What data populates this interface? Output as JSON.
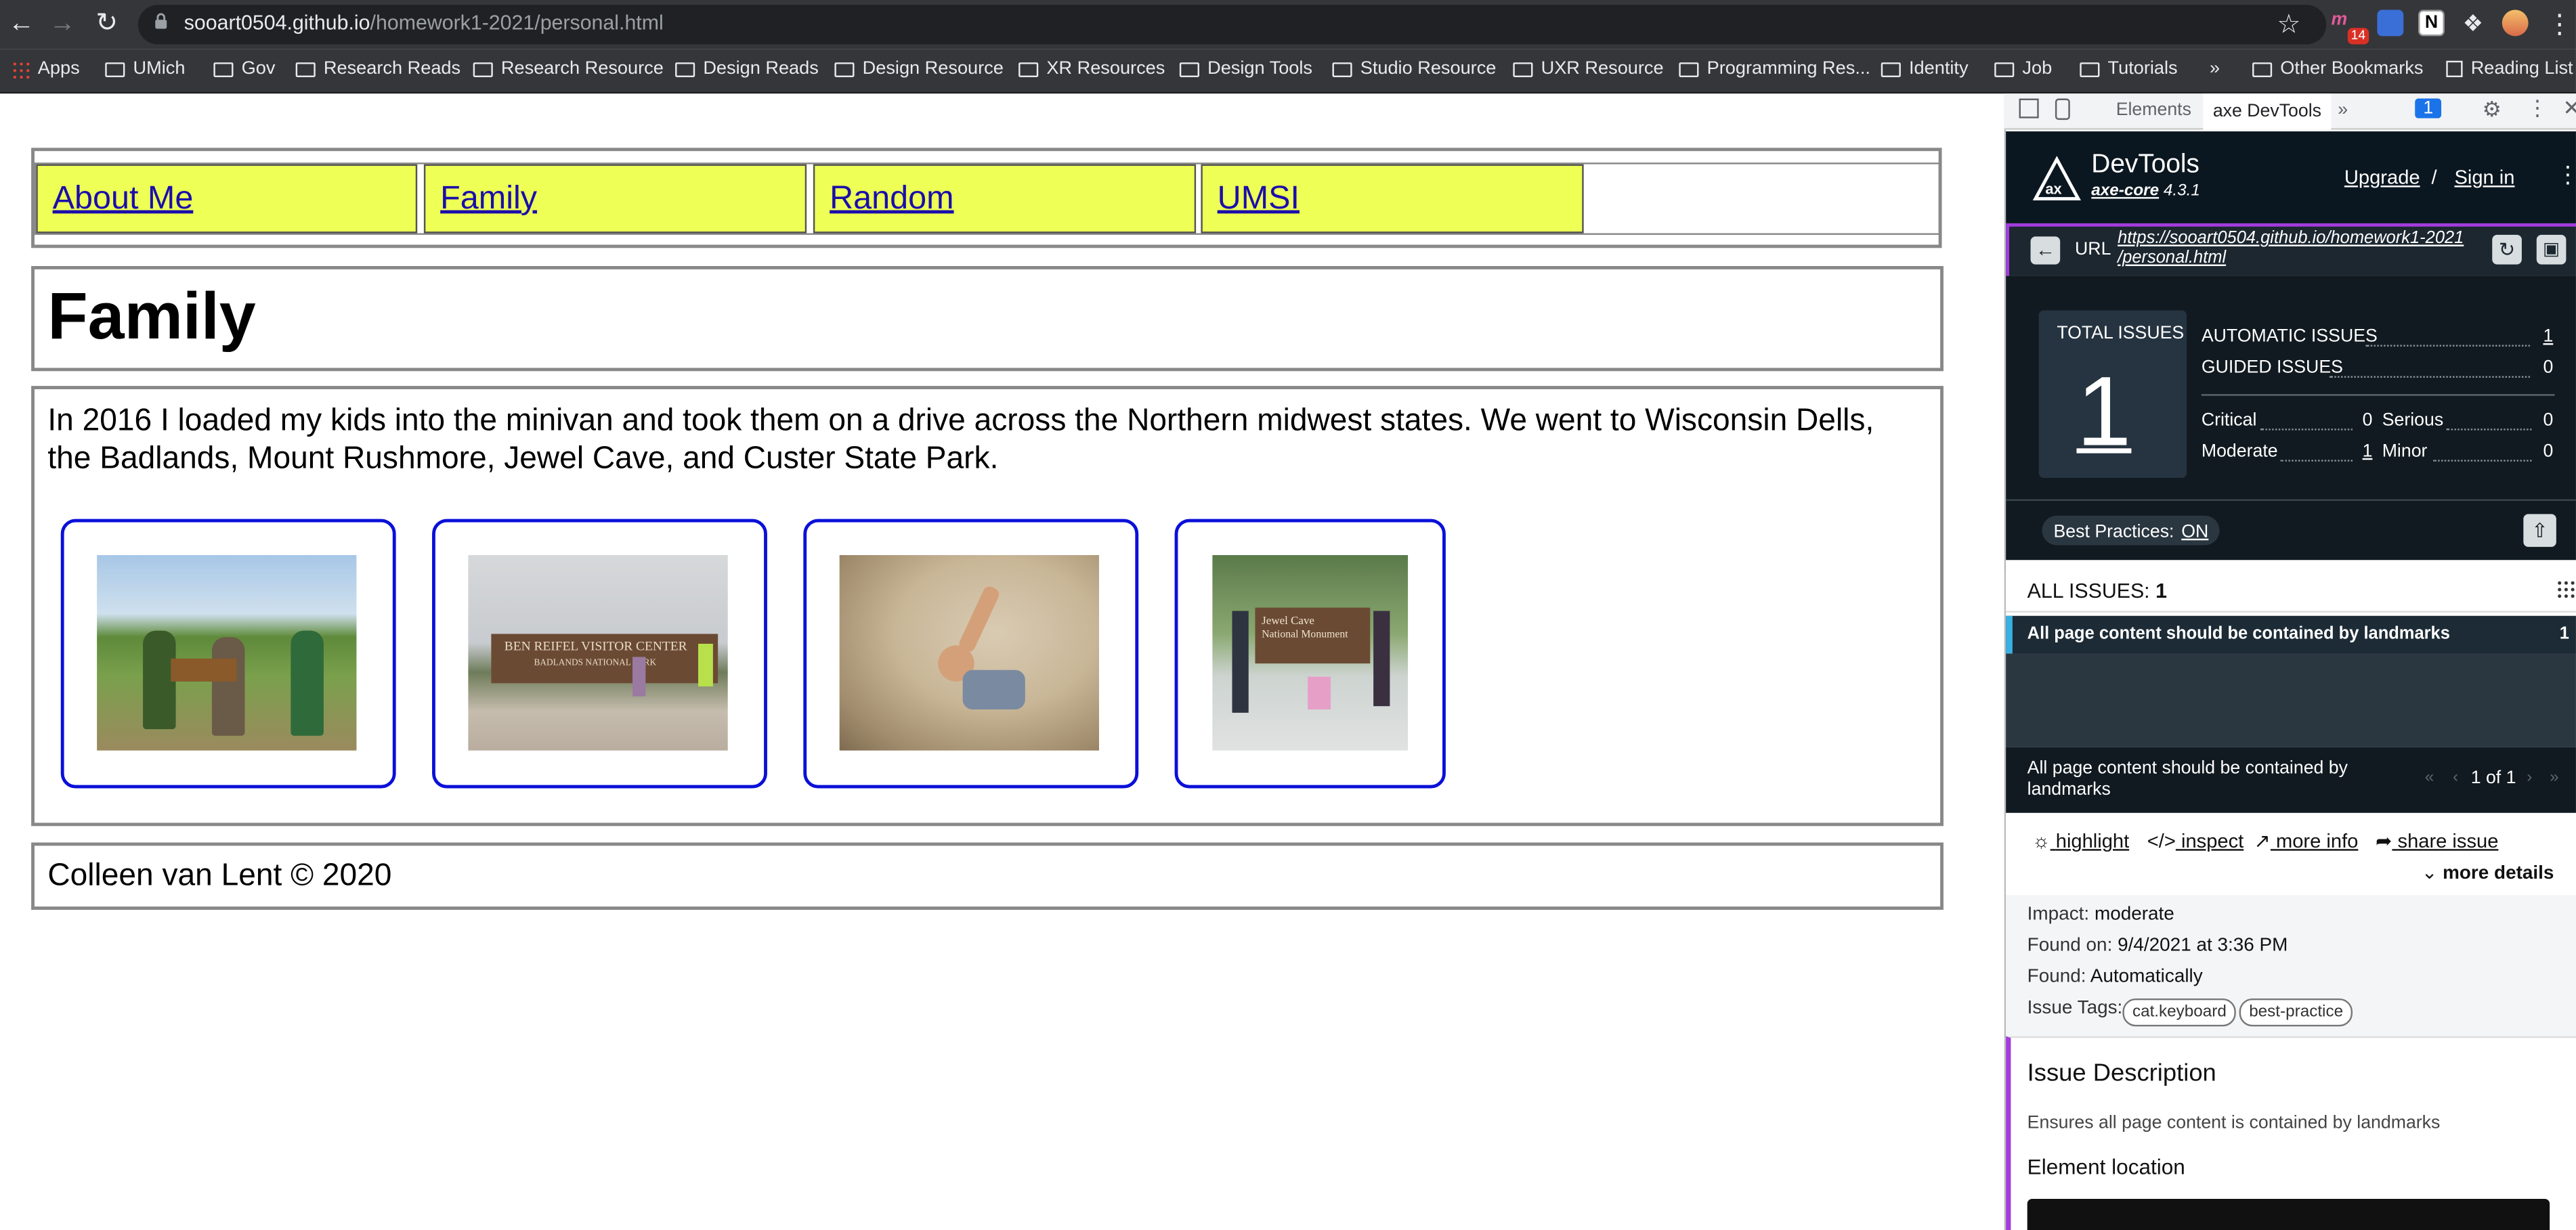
{
  "browser": {
    "url_domain": "sooart0504.github.io",
    "url_path": "/homework1-2021/personal.html",
    "bookmarks": [
      "Apps",
      "UMich",
      "Gov",
      "Research Reads",
      "Research Resource",
      "Design Reads",
      "Design Resource",
      "XR Resources",
      "Design Tools",
      "Studio Resource",
      "UXR Resource",
      "Programming Res...",
      "Identity",
      "Job",
      "Tutorials"
    ],
    "bookmarks_overflow": "»",
    "other_bookmarks": "Other Bookmarks",
    "reading_list": "Reading List",
    "extension_badge": "14"
  },
  "page": {
    "nav": [
      "About Me",
      "Family",
      "Random",
      "UMSI"
    ],
    "heading": "Family",
    "paragraph": "In 2016 I loaded my kids into the minivan and took them on a drive across the Northern midwest states. We went to Wisconsin Dells, the Badlands, Mount Rushmore, Jewel Cave, and Custer State Park.",
    "photos": [
      {
        "sign": ""
      },
      {
        "sign": "BEN REIFEL VISITOR CENTER",
        "sign2": "BADLANDS NATIONAL PARK"
      },
      {
        "sign": ""
      },
      {
        "sign": "Jewel Cave",
        "sign2": "National Monument"
      }
    ],
    "footer": "Colleen van Lent © 2020"
  },
  "devtools": {
    "tabs": {
      "elements": "Elements",
      "axe": "axe DevTools",
      "more": "»",
      "msg_count": "1"
    },
    "axe_title": "DevTools",
    "axe_core": "axe-core",
    "axe_version": "4.3.1",
    "upgrade": "Upgrade",
    "slash": "/",
    "sign_in": "Sign in",
    "url_label": "URL",
    "url_value_1": "https://sooart0504.github.io/homework1-2021",
    "url_value_2": "/personal.html",
    "total_label": "TOTAL ISSUES",
    "total": "1",
    "automatic_label": "AUTOMATIC ISSUES",
    "automatic": "1",
    "guided_label": "GUIDED ISSUES",
    "guided": "0",
    "critical_label": "Critical",
    "critical": "0",
    "serious_label": "Serious",
    "serious": "0",
    "moderate_label": "Moderate",
    "moderate": "1",
    "minor_label": "Minor",
    "minor": "0",
    "best_practices_label": "Best Practices:",
    "best_practices_value": "ON",
    "all_issues_label": "ALL ISSUES:",
    "all_issues": "1",
    "issue_title": "All page content should be contained by landmarks",
    "issue_count": "1",
    "detail_title": "All page content should be contained by landmarks",
    "pager": "1 of 1",
    "actions": {
      "highlight": "highlight",
      "inspect": "inspect",
      "more_info": "more info",
      "share": "share issue",
      "more_details": "more details"
    },
    "impact_label": "Impact:",
    "impact": "moderate",
    "found_on_label": "Found on:",
    "found_on": "9/4/2021 at 3:36 PM",
    "found_label": "Found:",
    "found": "Automatically",
    "tags_label": "Issue Tags:",
    "tags": [
      "cat.keyboard",
      "best-practice"
    ],
    "desc_title": "Issue Description",
    "desc_text": "Ensures all page content is contained by landmarks",
    "element_location": "Element location"
  },
  "colors": {
    "nav_bg": "#eeff55",
    "card_border": "#0a10d8",
    "axe_purple": "#a23cdc",
    "axe_dark": "#111a20"
  }
}
